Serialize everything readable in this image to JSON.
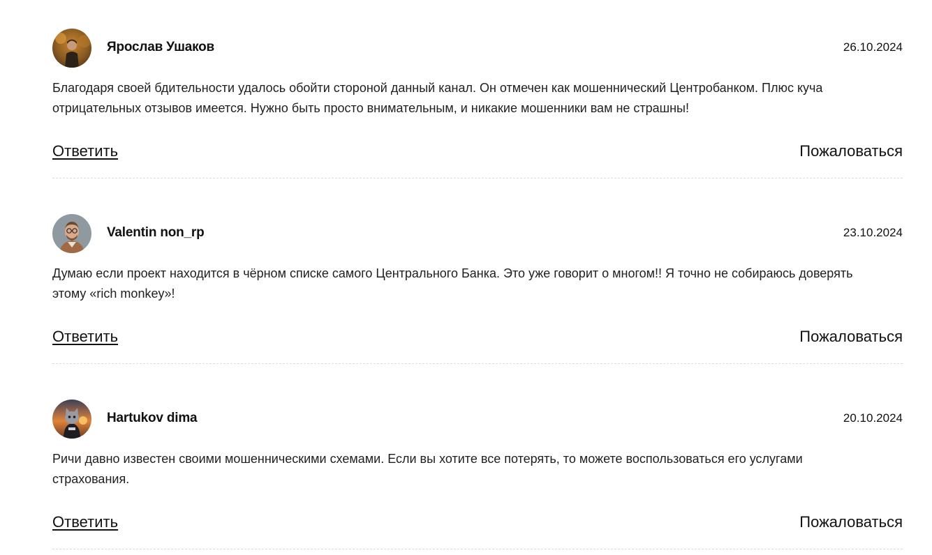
{
  "comments": [
    {
      "author": "Ярослав Ушаков",
      "date": "26.10.2024",
      "text": "Благодаря своей бдительности удалось обойти стороной данный канал. Он отмечен как мошеннический Центробанком. Плюс куча отрицательных отзывов имеется. Нужно быть просто внимательным, и никакие мошенники вам не страшны!",
      "reply_label": "Ответить",
      "report_label": "Пожаловаться",
      "avatar_icon": "person-autumn-photo"
    },
    {
      "author": "Valentin non_rp",
      "date": "23.10.2024",
      "text": "Думаю если проект находится в чёрном списке самого Центрального Банка. Это уже говорит о многом!! Я точно не собираюсь доверять этому «rich monkey»!",
      "reply_label": "Ответить",
      "report_label": "Пожаловаться",
      "avatar_icon": "man-glasses-photo"
    },
    {
      "author": "Hartukov dima",
      "date": "20.10.2024",
      "text": "Ричи давно известен своими мошенническими схемами. Если вы хотите все потерять, то можете воспользоваться его услугами страхования.",
      "reply_label": "Ответить",
      "report_label": "Пожаловаться",
      "avatar_icon": "cat-sunset-photo"
    }
  ],
  "colors": {
    "text": "#1f1f1f",
    "divider": "#dcdcdc"
  }
}
